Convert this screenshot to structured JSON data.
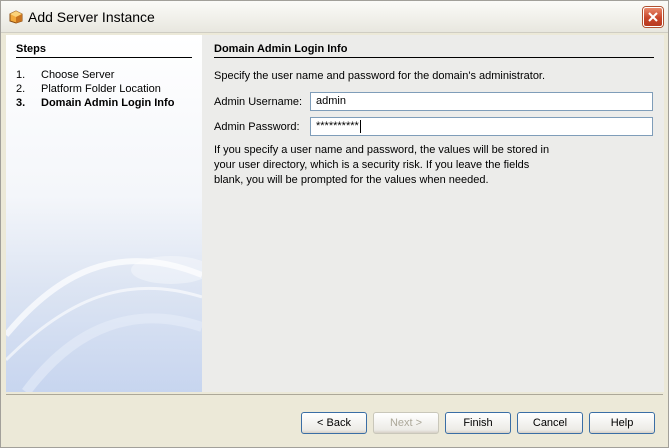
{
  "window": {
    "title": "Add Server Instance",
    "app_icon": "netbeans-icon",
    "close_icon": "close-icon"
  },
  "steps": {
    "header": "Steps",
    "items": [
      {
        "number": "1.",
        "label": "Choose Server",
        "current": false
      },
      {
        "number": "2.",
        "label": "Platform Folder Location",
        "current": false
      },
      {
        "number": "3.",
        "label": "Domain Admin Login Info",
        "current": true
      }
    ]
  },
  "main": {
    "section_title": "Domain Admin Login Info",
    "description": "Specify the user name and password for the domain's administrator.",
    "username": {
      "label": "Admin Username:",
      "value": "admin"
    },
    "password": {
      "label": "Admin Password:",
      "value": "**********"
    },
    "info_text": "If you specify a user name and password, the values will be stored in your user directory, which is a security risk. If you leave the fields blank, you will be prompted for the values when needed."
  },
  "buttons": {
    "back": "< Back",
    "next": "Next >",
    "finish": "Finish",
    "cancel": "Cancel",
    "help": "Help"
  },
  "colors": {
    "accent": "#3a6ea5",
    "close_button": "#c8452a",
    "panel_gradient_end": "#c7d5ef"
  }
}
